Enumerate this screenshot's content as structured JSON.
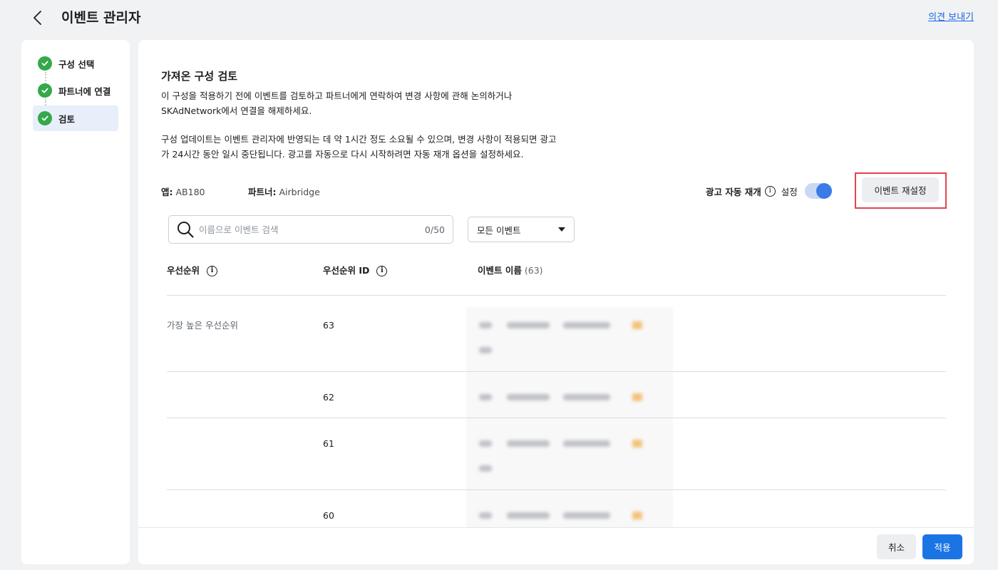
{
  "header": {
    "title": "이벤트 관리자",
    "feedback_link": "의견 보내기"
  },
  "sidebar": {
    "steps": [
      {
        "label": "구성 선택",
        "state": "complete"
      },
      {
        "label": "파트너에 연결",
        "state": "complete"
      },
      {
        "label": "검토",
        "state": "active"
      }
    ]
  },
  "review": {
    "title": "가져온 구성 검토",
    "para1_line1": "이 구성을 적용하기 전에 이벤트를 검토하고 파트너에게 연락하여 변경 사항에 관해 논의하거나",
    "para1_line2": "SKAdNetwork에서 연결을 해제하세요.",
    "para2_line1": "구성 업데이트는 이벤트 관리자에 반영되는 데 약 1시간 정도 소요될 수 있으며, 변경 사항이 적용되면 광고",
    "para2_line2": "가 24시간 동안 일시 중단됩니다. 광고를 자동으로 다시 시작하려면 자동 재개 옵션을 설정하세요.",
    "app_label": "앱:",
    "app_value": "AB180",
    "partner_label": "파트너:",
    "partner_value": "Airbridge",
    "auto_restart_label": "광고 자동 재개",
    "auto_restart_state": "설정",
    "auto_restart_on": true,
    "reset_button": "이벤트 재설정"
  },
  "search": {
    "placeholder": "이름으로 이벤트 검색",
    "value": "",
    "count": "0/50"
  },
  "filter": {
    "selected": "모든 이벤트"
  },
  "table": {
    "col_priority": "우선순위",
    "col_priority_id": "우선순위 ID",
    "col_event_name": "이벤트 이름",
    "col_event_count": "(63)",
    "rows": [
      {
        "priority": "가장 높은 우선순위",
        "id": "63"
      },
      {
        "priority": "",
        "id": "62"
      },
      {
        "priority": "",
        "id": "61"
      },
      {
        "priority": "",
        "id": "60"
      }
    ]
  },
  "footer": {
    "cancel": "취소",
    "apply": "적용"
  },
  "colors": {
    "accent": "#1b74e4",
    "success": "#35a84a",
    "highlight": "#e0454c"
  },
  "icons": [
    "back-arrow-icon",
    "check-icon",
    "info-icon",
    "search-icon",
    "caret-down-icon",
    "warning-icon"
  ]
}
